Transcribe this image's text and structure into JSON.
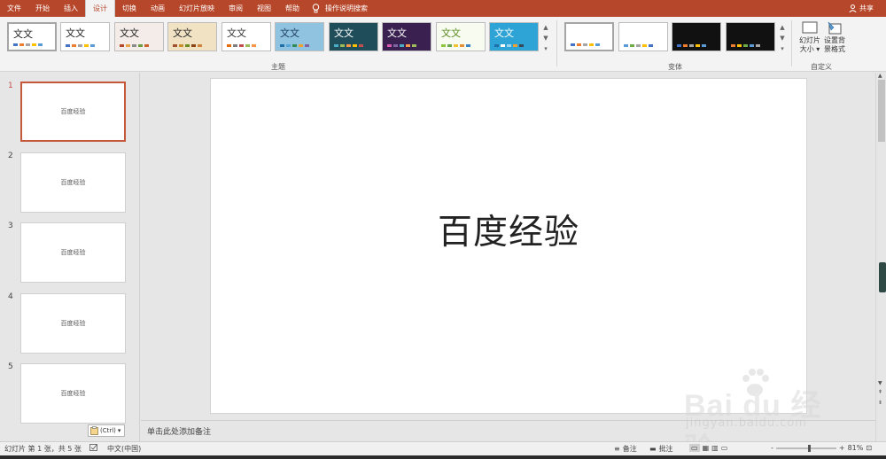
{
  "tabs": [
    {
      "label": "文件"
    },
    {
      "label": "开始"
    },
    {
      "label": "插入"
    },
    {
      "label": "设计"
    },
    {
      "label": "切换"
    },
    {
      "label": "动画"
    },
    {
      "label": "幻灯片放映"
    },
    {
      "label": "审阅"
    },
    {
      "label": "视图"
    },
    {
      "label": "帮助"
    }
  ],
  "tell_me": "操作说明搜索",
  "share_label": "共享",
  "ribbon": {
    "themes_group_label": "主题",
    "variants_group_label": "变体",
    "customize_group_label": "自定义",
    "theme_sample_text": "文文",
    "slide_size_label_1": "幻灯片",
    "slide_size_label_2": "大小",
    "format_bg_label_1": "设置背",
    "format_bg_label_2": "景格式",
    "themes": [
      {
        "bg": "#ffffff",
        "fg": "#222222",
        "bars": [
          "#4472c4",
          "#ed7d31",
          "#a5a5a5",
          "#ffc000",
          "#5b9bd5"
        ]
      },
      {
        "bg": "#ffffff",
        "fg": "#222222",
        "bars": [
          "#4472c4",
          "#ed7d31",
          "#a5a5a5",
          "#ffc000",
          "#5b9bd5"
        ]
      },
      {
        "bg": "#f4ece8",
        "fg": "#222222",
        "bars": [
          "#b7472a",
          "#e7a14b",
          "#8a8a8a",
          "#6e9a42",
          "#c9622b"
        ]
      },
      {
        "bg": "#f1e2c4",
        "fg": "#222222",
        "bars": [
          "#a0522d",
          "#c8902c",
          "#6b8e23",
          "#8b4513",
          "#cd853f"
        ]
      },
      {
        "bg": "#ffffff",
        "fg": "#333333",
        "bars": [
          "#e46c0a",
          "#7f7f7f",
          "#c0504d",
          "#9bbb59",
          "#f79646"
        ]
      },
      {
        "bg": "#8fc3e0",
        "fg": "#1b3a5b",
        "bars": [
          "#1f6fa8",
          "#53a6d6",
          "#2e8b57",
          "#f0a030",
          "#8064a2"
        ]
      },
      {
        "bg": "#1f4e5a",
        "fg": "#ffffff",
        "bars": [
          "#4bacc6",
          "#9bbb59",
          "#f79646",
          "#ffc000",
          "#c0504d"
        ]
      },
      {
        "bg": "#3a2050",
        "fg": "#ffffff",
        "bars": [
          "#d35ab0",
          "#8064a2",
          "#4bacc6",
          "#f79646",
          "#9bbb59"
        ]
      },
      {
        "bg": "#f7fbf0",
        "fg": "#5a8a1e",
        "bars": [
          "#8dc63f",
          "#6aa84f",
          "#f1c232",
          "#e69138",
          "#3d85c6"
        ]
      },
      {
        "bg": "#2ea3d6",
        "fg": "#ffffff",
        "bars": [
          "#1f6fa8",
          "#ffffff",
          "#9bd4ee",
          "#f0a030",
          "#34495e"
        ]
      }
    ],
    "variants": [
      {
        "bg": "#ffffff",
        "bars": [
          "#4472c4",
          "#ed7d31",
          "#a5a5a5",
          "#ffc000",
          "#5b9bd5"
        ]
      },
      {
        "bg": "#ffffff",
        "bars": [
          "#5b9bd5",
          "#70ad47",
          "#a5a5a5",
          "#ffc000",
          "#4472c4"
        ]
      },
      {
        "bg": "#111111",
        "bars": [
          "#4472c4",
          "#ed7d31",
          "#a5a5a5",
          "#ffc000",
          "#5b9bd5"
        ]
      },
      {
        "bg": "#111111",
        "bars": [
          "#ed7d31",
          "#ffc000",
          "#70ad47",
          "#5b9bd5",
          "#a5a5a5"
        ]
      }
    ]
  },
  "slides": [
    {
      "number": "1",
      "text": "百度经验"
    },
    {
      "number": "2",
      "text": "百度经验"
    },
    {
      "number": "3",
      "text": "百度经验"
    },
    {
      "number": "4",
      "text": "百度经验"
    },
    {
      "number": "5",
      "text": "百度经验"
    }
  ],
  "paste_options_label": "(Ctrl)",
  "current_slide": {
    "title": "百度经验"
  },
  "notes_placeholder": "单击此处添加备注",
  "status": {
    "slide_info": "幻灯片 第 1 张，共 5 张",
    "language": "中文(中国)",
    "notes_btn": "备注",
    "comments_btn": "批注",
    "zoom_minus": "-",
    "zoom_plus": "+",
    "zoom_percent": "81%"
  },
  "watermark": {
    "brand": "Bai du 经验",
    "site": "jingyan.baidu.com"
  },
  "colors": {
    "accent": "#b7472a",
    "selection": "#c5573a"
  }
}
